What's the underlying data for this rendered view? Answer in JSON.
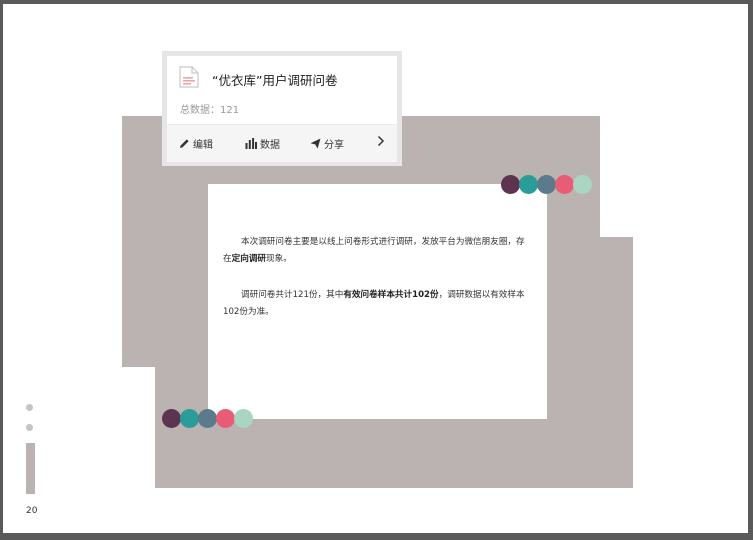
{
  "survey": {
    "title": "“优衣库”用户调研问卷",
    "count_label": "总数据：121",
    "actions": {
      "edit": "编辑",
      "data": "数据",
      "share": "分享"
    },
    "icons": [
      "document-icon",
      "pencil-icon",
      "bar-chart-icon",
      "paper-plane-icon",
      "chevron-right-icon"
    ]
  },
  "content": {
    "p1_a": "本次调研问卷主要是以线上问卷形式进行调研，发放平台为微信朋友圈，存在",
    "p1_bold": "定向调研",
    "p1_b": "现象。",
    "p2_a": "调研问卷共计121份，其中",
    "p2_bold": "有效问卷样本共计102份",
    "p2_b": "，调研数据以有效样本102份为准。"
  },
  "palette": [
    "#5c3450",
    "#2a9d99",
    "#5b7a8c",
    "#e85d75",
    "#a9d5c2"
  ],
  "accent_grey": "#bab3b2",
  "page_number": "20"
}
